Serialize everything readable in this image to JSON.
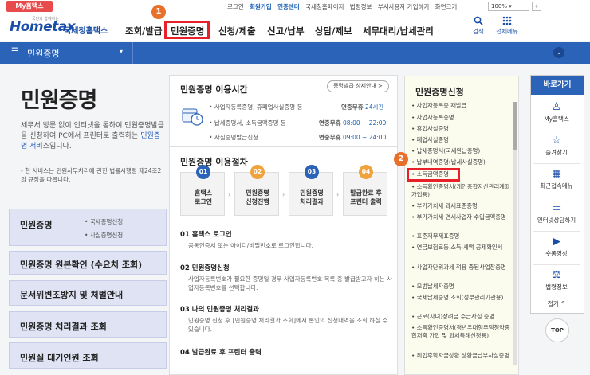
{
  "topbar": {
    "my_home": "My홈택스",
    "links": [
      "로그인",
      "회원가입",
      "인증센터",
      "국세청홈페이지",
      "법령정보",
      "부서사용자 가입하기",
      "화면크기"
    ],
    "zoom": "100%",
    "zoom_toggle": "+"
  },
  "logo": {
    "slogan": "국민과 함께하는",
    "brand": "Hometax",
    "org": "국세청홈택스"
  },
  "nav": [
    "조회/발급",
    "민원증명",
    "신청/제출",
    "신고/납부",
    "상담/제보",
    "세무대리/납세관리"
  ],
  "header_icons": {
    "search": "검색",
    "all_menu": "전체메뉴"
  },
  "badges": {
    "one": "1",
    "two": "2"
  },
  "subnav": {
    "title": "민원증명"
  },
  "left": {
    "title": "민원증명",
    "desc_pre": "세무서 방문 없이 인터넷을 통하여 민원증명발급을 신청하여 PC에서 프린터로 출력하는 ",
    "desc_link": "민원증명 서비",
    "desc_post": "스입니다.",
    "note": "- 현 서비스는 민원사무처리에 관한 법률시행령 제24조2의 규정을 따릅니다.",
    "buttons": [
      {
        "label": "민원증명",
        "subs": [
          "국세증명신청",
          "사실증명신청"
        ]
      },
      {
        "label": "민원증명 원본확인 (수요처 조회)"
      },
      {
        "label": "문서위변조방지 및 처벌안내"
      },
      {
        "label": "민원증명 처리결과 조회"
      },
      {
        "label": "민원실 대기인원 조회"
      }
    ]
  },
  "hours": {
    "title": "민원증명 이용시간",
    "detail_btn": "증명발급 상세안내 >",
    "rows": [
      {
        "name": "사업자등록증명, 휴폐업사실증명 등",
        "label": "연중무휴",
        "time": "24시간"
      },
      {
        "name": "납세증명서, 소득금액증명 등",
        "label": "연중무휴",
        "time": "08:00 ~ 22:00"
      },
      {
        "name": "사실증명발급신청",
        "label": "연중무휴",
        "time": "09:00 ~ 24:00"
      }
    ]
  },
  "process": {
    "title": "민원증명 이용절차",
    "steps": [
      {
        "num": "01",
        "label1": "홈택스",
        "label2": "로그인",
        "color": "#2a63b8"
      },
      {
        "num": "02",
        "label1": "민원증명",
        "label2": "신청진행",
        "color": "#f0a33c"
      },
      {
        "num": "03",
        "label1": "민원증명",
        "label2": "처리결과",
        "color": "#2a63b8"
      },
      {
        "num": "04",
        "label1": "발급완료 후",
        "label2": "프린터 출력",
        "color": "#f0a33c"
      }
    ],
    "details": [
      {
        "title": "01 홈택스 로그인",
        "desc": "공동인증서 또는 아이디/비밀번호로 로그인합니다."
      },
      {
        "title": "02 민원증명신청",
        "desc": "사업자등록번호가 필요한 증명일 경우 사업자등록번호 목록 중 발급받고자 하는 사업자등록번호를 선택합니다."
      },
      {
        "title": "03 나의 민원증명 처리결과",
        "desc": "민원증명 신청 후 [민원증명 처리결과 조회]에서 본인의 신청내역을 조회 하실 수 있습니다."
      },
      {
        "title": "04 발급완료 후 프린터 출력",
        "desc": ""
      }
    ]
  },
  "apply": {
    "title": "민원증명신청",
    "items": [
      "사업자등록증 재발급",
      "사업자등록증명",
      "휴업사실증명",
      "폐업사실증명",
      "납세증명서(국세완납증명)",
      "납부내역증명(납세사실증명)",
      "소득금액증명",
      "소득확인증명서(개인종합자산관리계좌 가입용)",
      "부가가치세 과세표준증명",
      "부가가치세 면세사업자 수입금액증명",
      "표준재무제표증명",
      "연금보험료등 소득·세액 공제확인서",
      "사업자단위과세 적용 종된사업장증명",
      "모범납세자증명",
      "국세납세증명 조회(정부관리기관용)",
      "근로(자녀)장려금 수급사실 증명",
      "소득확인증명서(청년우대형주택청약종합저축 가입 및 과세특례신청용)",
      "취업후학자금상환 상환금납부사실증명"
    ]
  },
  "quick": {
    "title": "바로가기",
    "items": [
      {
        "icon": "person-icon",
        "label": "My홈택스"
      },
      {
        "icon": "star-icon",
        "label": "즐겨찾기"
      },
      {
        "icon": "calendar-icon",
        "label": "최근접속메뉴"
      },
      {
        "icon": "laptop-icon",
        "label": "인터넷상담하기"
      },
      {
        "icon": "play-icon",
        "label": "숏폼영상"
      },
      {
        "icon": "law-icon",
        "label": "법령정보"
      }
    ],
    "collapse": "접기 ^",
    "top": "TOP"
  }
}
